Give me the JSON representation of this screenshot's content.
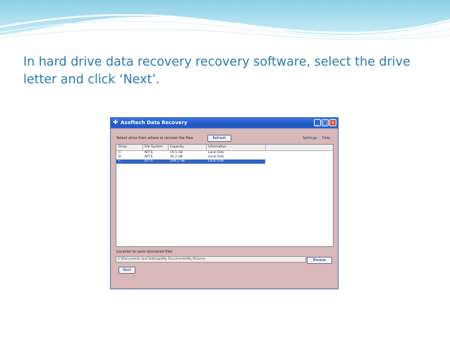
{
  "slide": {
    "instruction": "In hard drive data recovery recovery software, select the drive letter and click ‘Next’."
  },
  "window": {
    "title": "Asoftech Data Recovery",
    "controls": {
      "minimize": "_",
      "maximize": "□",
      "close": "×"
    },
    "select_label": "Select drive from where to recover the files",
    "refresh_label": "Refresh",
    "settings_label": "Settings",
    "help_label": "Help",
    "table": {
      "columns": [
        "Drive",
        "File System",
        "Capacity",
        "Information"
      ],
      "rows": [
        [
          "C:",
          "NTFS",
          "19.5 GB",
          "Local Disk"
        ],
        [
          "D:",
          "NTFS",
          "92.2 GB",
          "Local Disk"
        ],
        [
          "F:",
          "NTFS",
          "298.1 GB",
          "Local Disk"
        ]
      ],
      "selected_row": 2
    },
    "folder_label": "Location to save recovered files",
    "folder_value": "C:\\Documents and Settings\\My Documents\\My Pictures",
    "browse_label": "Browse",
    "next_label": "Next"
  },
  "colors": {
    "title_text": "#2a7ab0",
    "window_bg": "#d8b8b8",
    "titlebar": "#1f56c4",
    "selection": "#3163c6"
  }
}
